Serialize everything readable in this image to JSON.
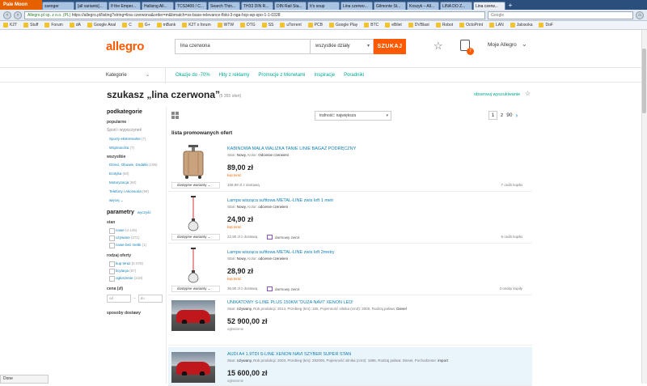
{
  "browser": {
    "app_button": "Pale Moon",
    "tabs": [
      "ssenger",
      "[all variants]...",
      "If the Emper...",
      "Hallsing All...",
      "TCS3400 / C...",
      "Search Thin...",
      "TH33 DIN R...",
      "DIN Rail Sta...",
      "It's soup",
      "Lina czerwo...",
      "Gilmonte St...",
      "Koszyk – All...",
      "LINA DO Z...",
      "Lina czerw..."
    ],
    "active_tab": 13,
    "url": "https://allegro.pl/listing?string=lina czerwona&order=m&bmatch=ss-base-relevance-floki-3-nga-hcp-wp-spo-1-1-0328",
    "url_site": "Allegro.pl sp. z o.o. (PL)",
    "search_placeholder": "Google",
    "bookmarks": [
      "K2T",
      "Stuff",
      "Forum",
      "dA",
      "Google Anal",
      "C",
      "G+",
      "mBank",
      "K2T o forum",
      "WTW",
      "DTG",
      "SS",
      "uTorrent",
      "PCB",
      "Google Play",
      "BTC",
      "eBilet",
      "DVBlast",
      "Robot",
      "OctoPrint",
      "LAN",
      "Jalosoka",
      "DoF"
    ]
  },
  "header": {
    "logo": "allegro",
    "search_value": "lina czerwona",
    "category_select": "wszystkie działy",
    "search_button": "SZUKAJ",
    "cart_count": "7",
    "my_allegro": "Moje Allegro"
  },
  "catbar": {
    "categories": "Kategorie",
    "links": [
      "Okazje do -70%",
      "Hity z reklamy",
      "Promocje z Monetami",
      "Inspiracje",
      "Poradniki"
    ]
  },
  "results": {
    "title": "szukasz „lina czerwona”",
    "count": "(5 355 ofert)",
    "observe": "obserwuj wyszukiwanie"
  },
  "sidebar": {
    "subcategories_h": "podkategorie",
    "popular_h": "popularne",
    "popular": [
      "Sport i wypoczynek"
    ],
    "popular_links": [
      {
        "label": "Sporty ekstremalne",
        "count": "(7)"
      },
      {
        "label": "Wspinaczka",
        "count": "(7)"
      }
    ],
    "all_h": "wszystkie",
    "all_links": [
      {
        "label": "Dzieci, Obuwie, Dodatki",
        "count": "(195)"
      },
      {
        "label": "Erotyka",
        "count": "(60)"
      },
      {
        "label": "Motoryzacja",
        "count": "(60)"
      },
      {
        "label": "Telefony i Akcesoria",
        "count": "(99)"
      }
    ],
    "more": "więcej",
    "params_h": "parametry",
    "clear": "wyczyść",
    "state_h": "stan",
    "state": [
      {
        "label": "nowe",
        "count": "(4 145)"
      },
      {
        "label": "używane",
        "count": "(271)"
      },
      {
        "label": "nowe bez metki",
        "count": "(1)"
      }
    ],
    "offer_type_h": "rodzaj oferty",
    "offer_type": [
      {
        "label": "kup teraz",
        "count": "(5 079)"
      },
      {
        "label": "licytacja",
        "count": "(87)"
      },
      {
        "label": "ogłoszenie",
        "count": "(218)"
      }
    ],
    "price_h": "cena (zł)",
    "price_from": "od",
    "price_to": "do",
    "delivery_h": "sposoby dostawy"
  },
  "toolbar": {
    "sort": "trafność: największa",
    "page": "1",
    "of": "z",
    "total_pages": "90",
    "next": "›"
  },
  "section_title": "lista promowanych ofert",
  "offers": [
    {
      "title": "KABINOWA MAŁA WALIZKA TANIE LINIE BAGAŻ PODRĘCZNY",
      "meta_k": "Stan: ",
      "meta_v": "Nowy, ",
      "meta_k2": "Kolor: ",
      "meta_v2": "Odcienie czerwieni",
      "price": "89,00 zł",
      "ptype": "kup teraz",
      "shipping": "108,99 zł z dostawą",
      "free": "",
      "variants": "dostępne warianty",
      "bought": "7 osób kupiło"
    },
    {
      "title": "Lampa wisząca sufitowa METAL-LINE zwis loft 1 metr",
      "meta_k": "Stan: ",
      "meta_v": "Nowy, ",
      "meta_k2": "Kolor: ",
      "meta_v2": "odcienie czerwieni",
      "price": "24,90 zł",
      "ptype": "kup teraz",
      "shipping": "22,90 zł z dostawą",
      "free": "darmowy zwrot",
      "variants": "dostępne warianty",
      "bought": "6 osób kupiło"
    },
    {
      "title": "Lampa wisząca sufitowa METAL-LINE zwis loft 2metry",
      "meta_k": "Stan: ",
      "meta_v": "Nowy, ",
      "meta_k2": "Kolor: ",
      "meta_v2": "odcienie czerwieni",
      "price": "28,90 zł",
      "ptype": "kup teraz",
      "shipping": "36,90 zł z dostawą",
      "free": "darmowy zwrot",
      "variants": "dostępne warianty",
      "bought": "3 osoby kupiły"
    },
    {
      "title": "UNIKATOWY S-LINE PLUS 150KM \"DUŻA NAVI\" XENON LED!",
      "meta_k": "Stan: ",
      "meta_v": "Używany, ",
      "meta_k2": "Rok produkcji: 2014, Przebieg (km): 155, Pojemność silnika (cm3): 2000, Rodzaj paliwa: ",
      "meta_v2": "Diesel",
      "price": "52 900,00 zł",
      "ptype": "ogłoszenie",
      "shipping": "",
      "free": "",
      "variants": "",
      "bought": ""
    },
    {
      "title": "AUDI A4 1.9TDI S-LINE XENON NAVI SZYBER SUPER STAN",
      "meta_k": "Stan: ",
      "meta_v": "Używany, ",
      "meta_k2": "Rok produkcji: 2003, Przebieg (km): 292000, Pojemność silnika (cm3): 1896, Rodzaj paliwa: Diesel, Pochodzenie: ",
      "meta_v2": "import",
      "price": "15 600,00 zł",
      "ptype": "ogłoszenie",
      "shipping": "",
      "free": "",
      "variants": "",
      "bought": ""
    }
  ],
  "status": "Done"
}
